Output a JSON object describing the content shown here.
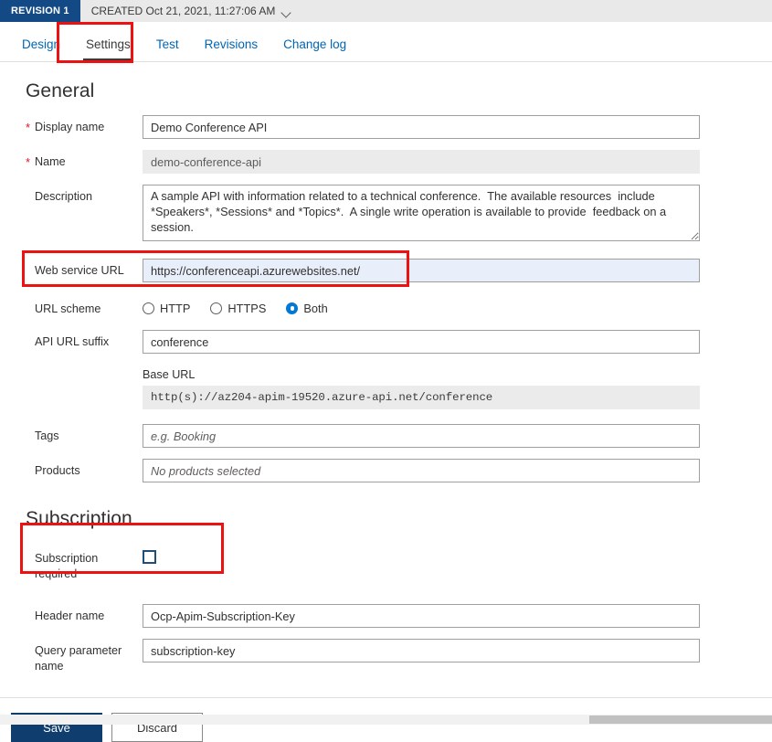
{
  "revision": {
    "badge": "REVISION 1",
    "created_text": "CREATED Oct 21, 2021, 11:27:06 AM",
    "chevron_icon": "chevron-down-icon"
  },
  "tabs": [
    {
      "label": "Design",
      "active": false
    },
    {
      "label": "Settings",
      "active": true
    },
    {
      "label": "Test",
      "active": false
    },
    {
      "label": "Revisions",
      "active": false
    },
    {
      "label": "Change log",
      "active": false
    }
  ],
  "general": {
    "title": "General",
    "display_name": {
      "label": "Display name",
      "required": "*",
      "value": "Demo Conference API"
    },
    "name": {
      "label": "Name",
      "required": "*",
      "value": "demo-conference-api"
    },
    "description": {
      "label": "Description",
      "value": "A sample API with information related to a technical conference.  The available resources  include *Speakers*, *Sessions* and *Topics*.  A single write operation is available to provide  feedback on a session."
    },
    "web_service_url": {
      "label": "Web service URL",
      "value": "https://conferenceapi.azurewebsites.net/"
    },
    "url_scheme": {
      "label": "URL scheme",
      "options": [
        {
          "label": "HTTP",
          "selected": false
        },
        {
          "label": "HTTPS",
          "selected": false
        },
        {
          "label": "Both",
          "selected": true
        }
      ]
    },
    "api_url_suffix": {
      "label": "API URL suffix",
      "value": "conference"
    },
    "base_url": {
      "label": "Base URL",
      "value": "http(s)://az204-apim-19520.azure-api.net/conference"
    },
    "tags": {
      "label": "Tags",
      "value": "",
      "placeholder": "e.g. Booking"
    },
    "products": {
      "label": "Products",
      "value": "",
      "placeholder": "No products selected"
    }
  },
  "subscription": {
    "title": "Subscription",
    "required": {
      "label_line1": "Subscription",
      "label_line2": "required",
      "checked": false
    },
    "header_name": {
      "label": "Header name",
      "value": "Ocp-Apim-Subscription-Key"
    },
    "query_parameter_name": {
      "label_line1": "Query parameter",
      "label_line2": "name",
      "value": "subscription-key"
    }
  },
  "footer": {
    "save_label": "Save",
    "discard_label": "Discard"
  },
  "colors": {
    "accent_blue": "#0078d4",
    "link_blue": "#0066b4",
    "badge_navy": "#134a86",
    "primary_button": "#0f3e6e",
    "annotation_red": "#ee1111",
    "required_red": "#e81123",
    "focus_field_bg": "#e9effa"
  }
}
